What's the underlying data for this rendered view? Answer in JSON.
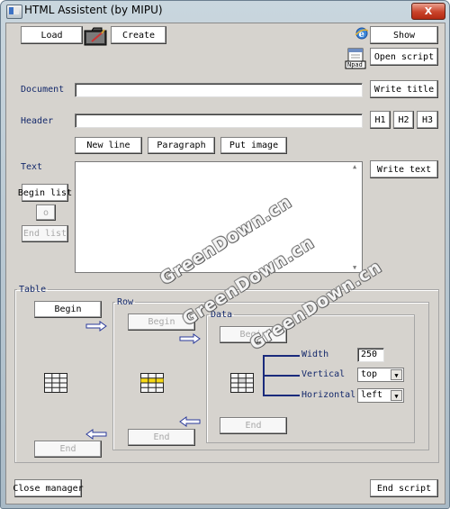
{
  "window": {
    "title": "HTML Assistent (by MIPU)",
    "close_glyph": "X"
  },
  "toolbar": {
    "load": "Load",
    "create": "Create",
    "show": "Show",
    "open_script": "Open script",
    "notepad_icon_caption": "Npad"
  },
  "document": {
    "label": "Document",
    "value": "",
    "button": "Write title"
  },
  "header": {
    "label": "Header",
    "value": "",
    "h1": "H1",
    "h2": "H2",
    "h3": "H3"
  },
  "text_tools": {
    "new_line": "New line",
    "paragraph": "Paragraph",
    "put_image": "Put image"
  },
  "text": {
    "label": "Text",
    "value": "",
    "write_text": "Write text",
    "begin_list": "Begin list",
    "bullet": "o",
    "end_list": "End list"
  },
  "table": {
    "legend": "Table",
    "begin": "Begin",
    "end": "End",
    "row": {
      "legend": "Row",
      "begin": "Begin",
      "end": "End"
    },
    "data": {
      "legend": "Data",
      "begin": "Begin",
      "end": "End",
      "width_label": "Width",
      "width_value": "250",
      "vertical_label": "Vertical",
      "vertical_value": "top",
      "horizontal_label": "Horizontal",
      "horizontal_value": "left"
    }
  },
  "footer": {
    "close_manager": "Close manager",
    "end_script": "End script"
  },
  "watermark": [
    "GreenDown.cn",
    "GreenDown.cn",
    "GreenDown.cn"
  ]
}
